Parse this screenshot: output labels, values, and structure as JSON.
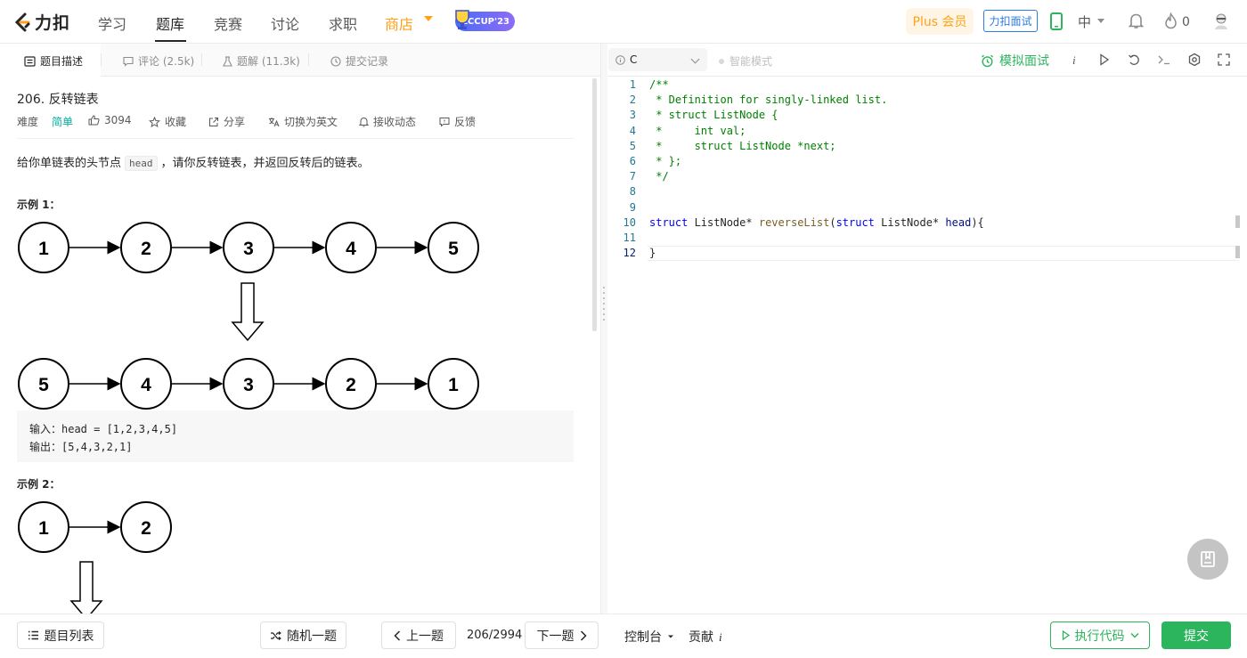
{
  "nav": {
    "logo_text": "力扣",
    "items": [
      "学习",
      "题库",
      "竞赛",
      "讨论",
      "求职"
    ],
    "active": "题库",
    "shop": "商店",
    "event_badge": "LCCUP'23",
    "plus": "Plus 会员",
    "interview": "力扣面试",
    "language": "中",
    "streak_count": "0"
  },
  "left_tabs": {
    "description": "题目描述",
    "comments": "评论 (2.5k)",
    "solutions": "题解 (11.3k)",
    "submissions": "提交记录"
  },
  "problem": {
    "title": "206. 反转链表",
    "difficulty_label": "难度",
    "difficulty": "简单",
    "likes": "3094",
    "favorite": "收藏",
    "share": "分享",
    "switch_lang": "切换为英文",
    "notify": "接收动态",
    "feedback": "反馈",
    "desc_prefix": "给你单链表的头节点",
    "desc_code": "head",
    "desc_suffix": "，请你反转链表，并返回反转后的链表。",
    "example1_title": "示例 1：",
    "example1_before": [
      "1",
      "2",
      "3",
      "4",
      "5"
    ],
    "example1_after": [
      "5",
      "4",
      "3",
      "2",
      "1"
    ],
    "example1_input": "输入：head = [1,2,3,4,5]",
    "example1_output": "输出：[5,4,3,2,1]",
    "example2_title": "示例 2：",
    "example2_before": [
      "1",
      "2"
    ]
  },
  "editor": {
    "language": "C",
    "smart_mode": "智能模式",
    "mock_interview": "模拟面试",
    "line_numbers": [
      "1",
      "2",
      "3",
      "4",
      "5",
      "6",
      "7",
      "8",
      "9",
      "10",
      "11",
      "12"
    ],
    "code": {
      "l1": "/**",
      "l2": " * Definition for singly-linked list.",
      "l3": " * struct ListNode {",
      "l4": " *     int val;",
      "l5": " *     struct ListNode *next;",
      "l6": " * };",
      "l7": " */",
      "l10_kw1": "struct",
      "l10_t1": " ListNode* ",
      "l10_fn": "reverseList",
      "l10_p1": "(",
      "l10_kw2": "struct",
      "l10_t2": " ListNode* ",
      "l10_var": "head",
      "l10_end": "){",
      "l12": "}"
    }
  },
  "bottom": {
    "problem_list": "题目列表",
    "random": "随机一题",
    "prev": "上一题",
    "page": "206/2994",
    "next": "下一题",
    "console": "控制台",
    "contribute": "贡献",
    "run": "执行代码",
    "submit": "提交"
  },
  "colors": {
    "brand_orange": "#ffa116",
    "easy_green": "#00af9b",
    "action_green": "#2db55d",
    "link_blue": "#2a7de1"
  }
}
